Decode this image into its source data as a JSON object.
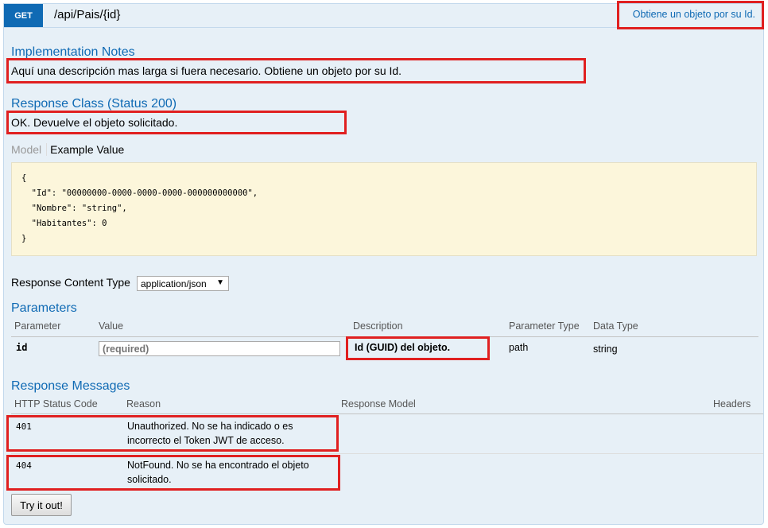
{
  "operation": {
    "method": "GET",
    "path": "/api/Pais/{id}",
    "summary": "Obtiene un objeto por su Id."
  },
  "implementation_notes": {
    "title": "Implementation Notes",
    "text": "Aquí una descripción mas larga si fuera necesario. Obtiene un objeto por su Id."
  },
  "response_class": {
    "title": "Response Class (Status 200)",
    "text": "OK. Devuelve el objeto solicitado.",
    "tab_model": "Model",
    "tab_example": "Example Value",
    "example": "{\n  \"Id\": \"00000000-0000-0000-0000-000000000000\",\n  \"Nombre\": \"string\",\n  \"Habitantes\": 0\n}"
  },
  "content_type": {
    "label": "Response Content Type",
    "selected": "application/json"
  },
  "parameters": {
    "title": "Parameters",
    "headers": [
      "Parameter",
      "Value",
      "Description",
      "Parameter Type",
      "Data Type"
    ],
    "rows": [
      {
        "name": "id",
        "placeholder": "(required)",
        "description": "Id (GUID) del objeto.",
        "param_type": "path",
        "data_type": "string"
      }
    ]
  },
  "response_messages": {
    "title": "Response Messages",
    "headers": [
      "HTTP Status Code",
      "Reason",
      "Response Model",
      "Headers"
    ],
    "rows": [
      {
        "code": "401",
        "reason_line1": "Unauthorized. No se ha indicado o es",
        "reason_line2": "incorrecto el Token JWT de acceso."
      },
      {
        "code": "404",
        "reason_line1": "NotFound. No se ha encontrado el objeto",
        "reason_line2": "solicitado."
      }
    ]
  },
  "try_button": "Try it out!",
  "colors": {
    "accent": "#0f6ab4",
    "highlight": "#e02020",
    "background": "#e7f0f7"
  }
}
